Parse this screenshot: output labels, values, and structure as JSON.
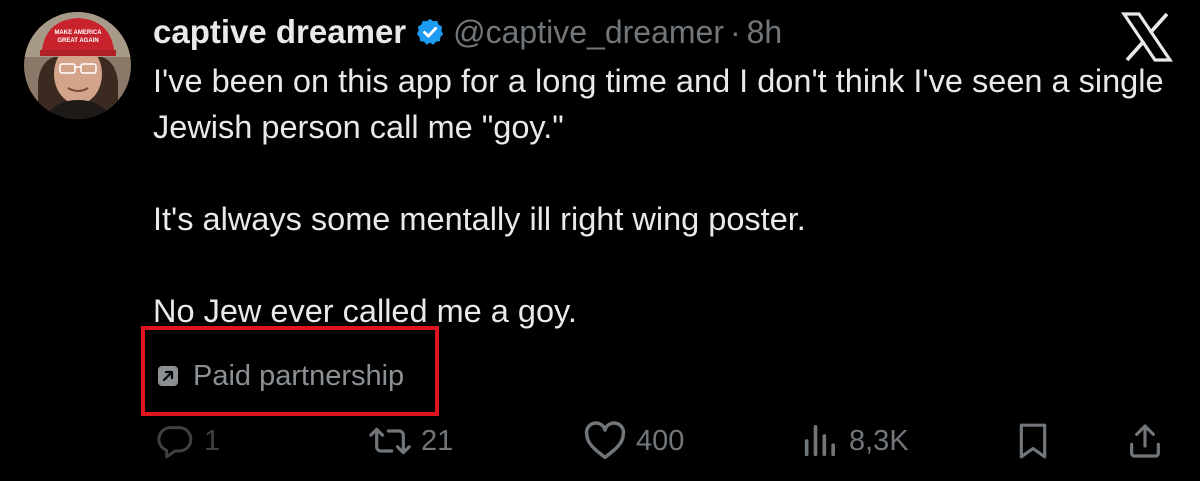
{
  "post": {
    "display_name": "captive dreamer",
    "handle": "@captive_dreamer",
    "separator": "·",
    "time": "8h",
    "text_lines": [
      "I've been on this app for a long time and I don't think I've seen a single Jewish person call me \"goy.\"",
      "It's always some mentally ill right wing poster.",
      "No Jew ever called me a goy."
    ],
    "paid_label": "Paid partnership",
    "avatar_hat_text": "MAKE AMERICA GREAT AGAIN"
  },
  "actions": {
    "replies": "1",
    "reposts": "21",
    "likes": "400",
    "views": "8,3K"
  },
  "colors": {
    "background": "#000000",
    "text": "#e7e9ea",
    "muted": "#71767b",
    "verified": "#1d9bf0",
    "highlight_box": "#e0141f"
  },
  "icons": {
    "app_logo": "x-logo-icon",
    "verified": "verified-badge-icon",
    "paid": "paid-partnership-icon",
    "reply": "reply-icon",
    "repost": "repost-icon",
    "like": "heart-icon",
    "views": "views-icon",
    "bookmark": "bookmark-icon",
    "share": "share-icon"
  }
}
